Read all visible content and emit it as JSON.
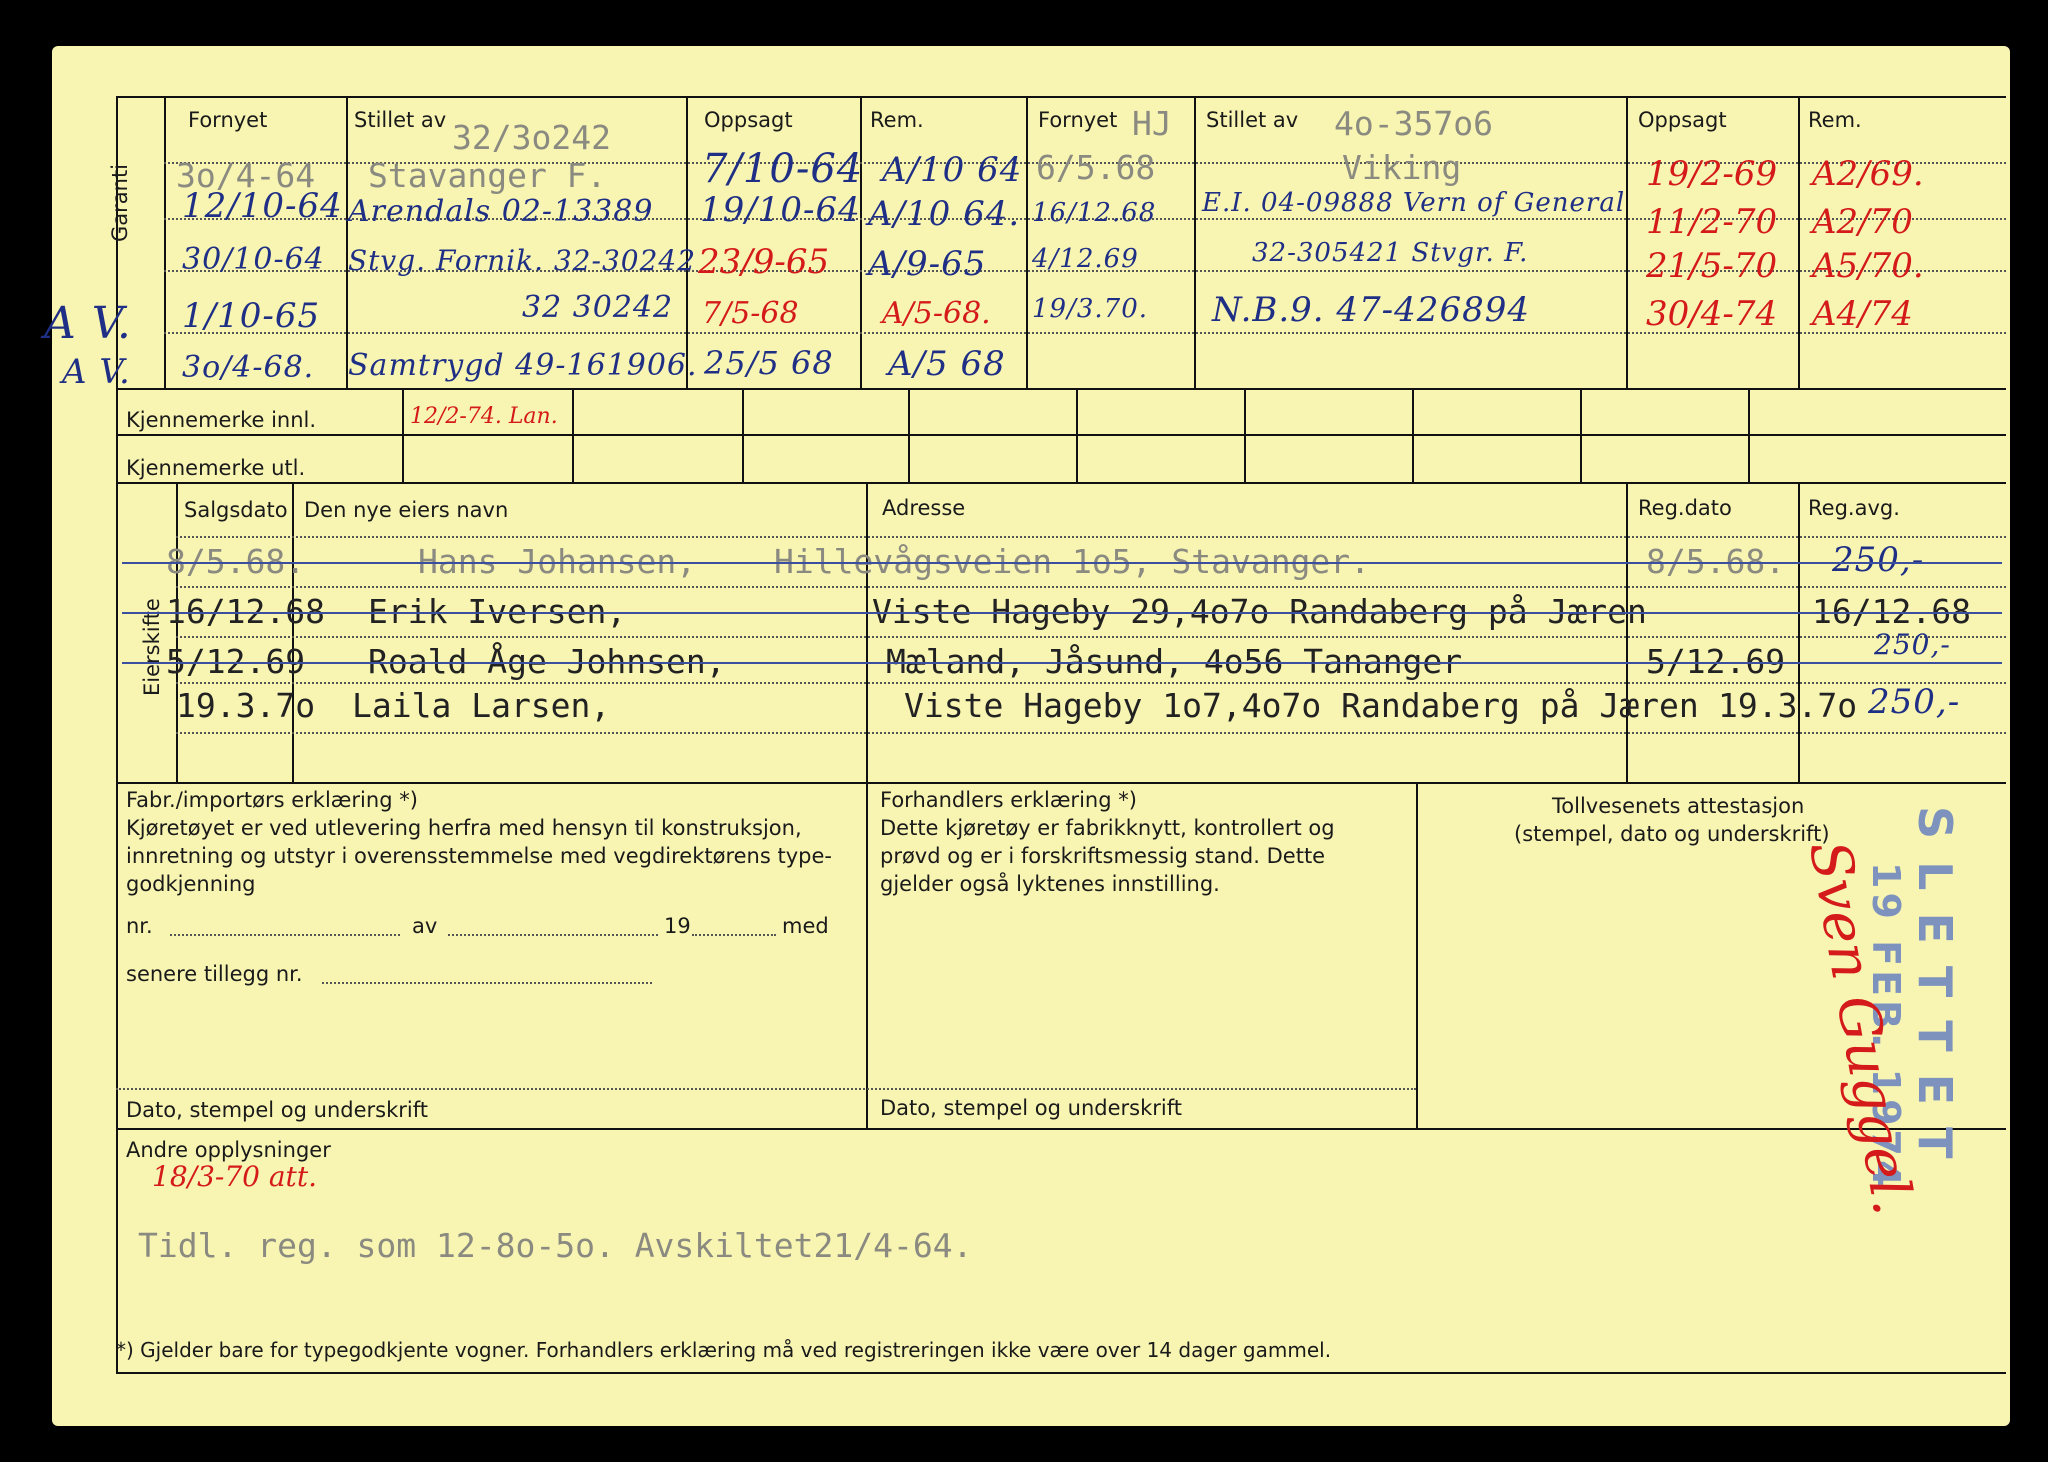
{
  "garanti": {
    "side_label": "Garanti",
    "headers": [
      "Fornyet",
      "Stillet av",
      "Oppsagt",
      "Rem.",
      "Fornyet",
      "Stillet av",
      "Oppsagt",
      "Rem."
    ],
    "left_rows": [
      {
        "fornyet": "3o/4-64",
        "stillet": "Stavanger F.",
        "oppsagt": "7/10-64",
        "rem": "A/10 64"
      },
      {
        "fornyet": "12/10-64",
        "stillet": "Arendals 02-13389",
        "oppsagt": "19/10-64",
        "rem": "A/10 64."
      },
      {
        "fornyet": "30/10-64",
        "stillet": "Stvg. Fornik. 32-30242",
        "oppsagt": "23/9-65",
        "rem": "A/9-65"
      },
      {
        "fornyet": "1/10-65",
        "stillet": "32 30242",
        "oppsagt": "7/5-68",
        "rem": "A/5-68."
      },
      {
        "fornyet": "3o/4-68.",
        "stillet": "Samtrygd 49-161906.",
        "oppsagt": "25/5 68",
        "rem": "A/5 68"
      }
    ],
    "left_stillet_number": "32/3o242",
    "right_rows": [
      {
        "fornyet": "6/5.68",
        "stillet": "Viking",
        "oppsagt": "19/2-69",
        "rem": "A2/69."
      },
      {
        "fornyet": "16/12.68",
        "stillet": "E.I. 04-09888 Vern of General",
        "oppsagt": "11/2-70",
        "rem": "A2/70"
      },
      {
        "fornyet": "4/12.69",
        "stillet": "32-305421 Stvgr. F.",
        "oppsagt": "21/5-70",
        "rem": "A5/70."
      },
      {
        "fornyet": "19/3.70.",
        "stillet": "N.B.9. 47-426894",
        "oppsagt": "30/4-74",
        "rem": "A4/74"
      }
    ],
    "right_fornyet_initials": "HJ",
    "right_stillet_number": "4o-357o6",
    "margin_marks": [
      "A V.",
      "A V."
    ]
  },
  "kjennemerke": {
    "innl_label": "Kjennemerke innl.",
    "innl_value": "12/2-74. Lan.",
    "utl_label": "Kjennemerke utl."
  },
  "eierskifte": {
    "side_label": "Eierskifte",
    "headers": [
      "Salgsdato",
      "Den nye eiers navn",
      "Adresse",
      "Reg.dato",
      "Reg.avg."
    ],
    "rows": [
      {
        "salgsdato": "8/5.68.",
        "navn": "Hans Johansen,",
        "adresse": "Hillevågsveien 1o5, Stavanger.",
        "regdato": "8/5.68.",
        "regavg": "250,-"
      },
      {
        "salgsdato": "16/12.68",
        "navn": "Erik Iversen,",
        "adresse": "Viste Hageby 29,4o7o Randaberg på Jæren",
        "regdato": "16/12.68",
        "regavg": ""
      },
      {
        "salgsdato": "5/12.69",
        "navn": "Roald Åge Johnsen,",
        "adresse": "Mæland, Jåsund, 4o56 Tananger",
        "regdato": "5/12.69",
        "regavg": "250,-"
      },
      {
        "salgsdato": "19.3.7o",
        "navn": "Laila Larsen,",
        "adresse": "Viste Hageby 1o7,4o7o Randaberg på Jæren",
        "regdato": "19.3.7o",
        "regavg": "250,-"
      }
    ]
  },
  "fabr": {
    "title": "Fabr./importørs erklæring *)",
    "body": [
      "Kjøretøyet er ved utlevering herfra med hensyn til konstruksjon,",
      "innretning og utstyr i overensstemmelse med vegdirektørens type-",
      "godkjenning"
    ],
    "nr_line": {
      "nr": "nr.",
      "av": "av",
      "year": "19",
      "med": "med"
    },
    "tillegg": "senere tillegg nr.",
    "sign": "Dato, stempel og underskrift"
  },
  "forhandler": {
    "title": "Forhandlers erklæring *)",
    "body": [
      "Dette kjøretøy er fabrikknytt, kontrollert og",
      "prøvd og er i forskriftsmessig stand. Dette",
      "gjelder også lyktenes innstilling."
    ],
    "sign": "Dato, stempel og underskrift"
  },
  "toll": {
    "title": "Tollvesenets attestasjon",
    "subtitle": "(stempel, dato og underskrift)"
  },
  "stamp": {
    "word": "SLETTET",
    "date": "19 FEB. 1974",
    "signature": "Sven Guggel."
  },
  "andre": {
    "label": "Andre opplysninger",
    "handwritten": "18/3-70 att.",
    "typed": "Tidl. reg. som 12-8o-5o. Avskiltet21/4-64."
  },
  "footnote": "*)  Gjelder bare for typegodkjente vogner.  Forhandlers erklæring må ved registreringen ikke være over 14 dager gammel.",
  "colors": {
    "card": "#f8f5b2",
    "ink_blue": "#1f2f85",
    "ink_red": "#d41a1a",
    "stamp": "#7d93bd"
  }
}
